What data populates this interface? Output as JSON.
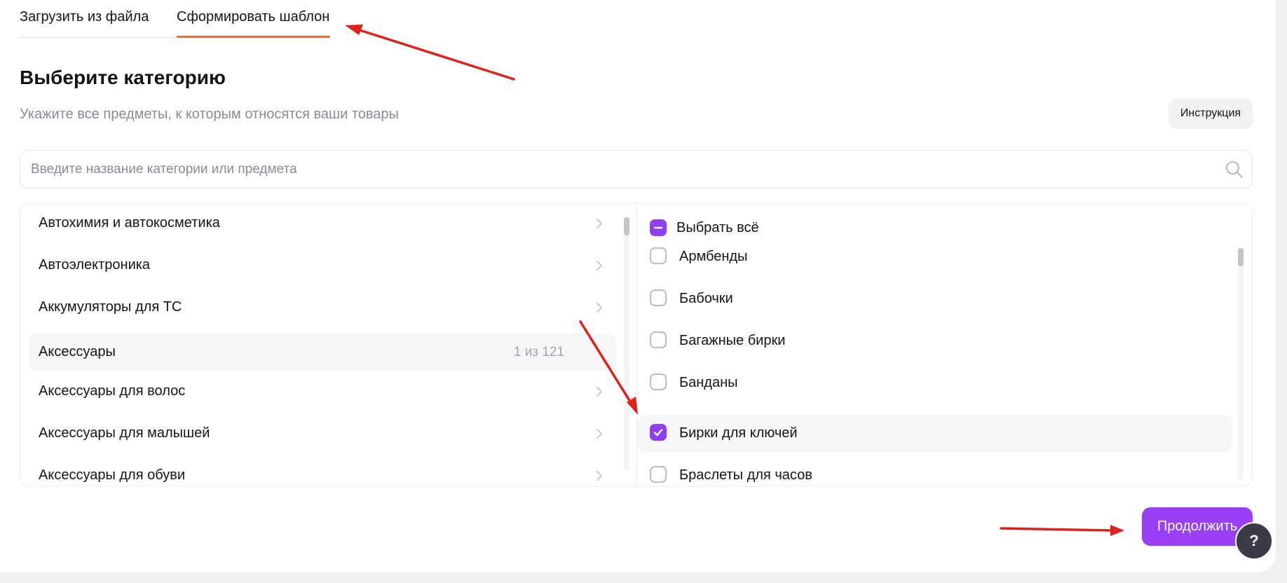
{
  "tabs": [
    {
      "label": "Загрузить из файла",
      "active": false
    },
    {
      "label": "Сформировать шаблон",
      "active": true
    }
  ],
  "colors": {
    "accent": "#9a3ff5",
    "tab_underline": "#f06a2f",
    "annotation_arrow": "#e0201b"
  },
  "header": {
    "title": "Выберите категорию",
    "subtitle": "Укажите все предметы, к которым относятся ваши товары",
    "instruction_label": "Инструкция"
  },
  "search": {
    "placeholder": "Введите название категории или предмета",
    "value": "",
    "icon": "search-icon"
  },
  "categories": [
    {
      "label": "Автохимия и автокосметика",
      "count": "",
      "active": false
    },
    {
      "label": "Автоэлектроника",
      "count": "",
      "active": false
    },
    {
      "label": "Аккумуляторы для ТС",
      "count": "",
      "active": false
    },
    {
      "label": "Аксессуары",
      "count": "1 из 121",
      "active": true
    },
    {
      "label": "Аксессуары для волос",
      "count": "",
      "active": false
    },
    {
      "label": "Аксессуары для малышей",
      "count": "",
      "active": false
    },
    {
      "label": "Аксессуары для обуви",
      "count": "",
      "active": false
    }
  ],
  "subjects": {
    "select_all_label": "Выбрать всё",
    "select_all_state": "partial",
    "items": [
      {
        "label": "Армбенды",
        "checked": false
      },
      {
        "label": "Бабочки",
        "checked": false
      },
      {
        "label": "Багажные бирки",
        "checked": false
      },
      {
        "label": "Банданы",
        "checked": false
      },
      {
        "label": "Бирки для ключей",
        "checked": true
      },
      {
        "label": "Браслеты для часов",
        "checked": false
      }
    ]
  },
  "footer": {
    "continue_label": "Продолжить",
    "help_label": "?"
  }
}
